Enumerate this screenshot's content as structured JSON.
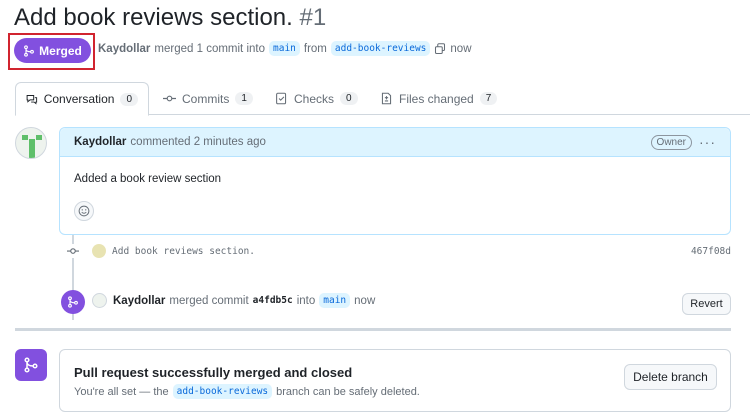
{
  "pr": {
    "title": "Add book reviews section.",
    "number": "#1",
    "state_label": "Merged",
    "author": "Kaydollar",
    "merge_text": "merged 1 commit into",
    "base_branch": "main",
    "from_text": "from",
    "head_branch": "add-book-reviews",
    "time": "now"
  },
  "tabs": [
    {
      "label": "Conversation",
      "count": "0",
      "icon": "comment-discussion-icon"
    },
    {
      "label": "Commits",
      "count": "1",
      "icon": "git-commit-icon"
    },
    {
      "label": "Checks",
      "count": "0",
      "icon": "checklist-icon"
    },
    {
      "label": "Files changed",
      "count": "7",
      "icon": "file-diff-icon"
    }
  ],
  "comment": {
    "author": "Kaydollar",
    "action": "commented 2 minutes ago",
    "role_badge": "Owner",
    "body": "Added a book review section"
  },
  "commit": {
    "message": "Add book reviews section.",
    "sha": "467f08d"
  },
  "merge_event": {
    "user": "Kaydollar",
    "action": "merged commit",
    "sha": "a4fdb5c",
    "into": "into",
    "branch": "main",
    "time": "now",
    "revert_label": "Revert"
  },
  "merge_status": {
    "title": "Pull request successfully merged and closed",
    "sub_prefix": "You're all set — the",
    "branch": "add-book-reviews",
    "sub_suffix": "branch can be safely deleted.",
    "delete_label": "Delete branch"
  },
  "colors": {
    "merged_purple": "#8250df",
    "highlight_red": "#d1242f",
    "branch_blue": "#0969da",
    "comment_header": "#ddf4ff"
  }
}
